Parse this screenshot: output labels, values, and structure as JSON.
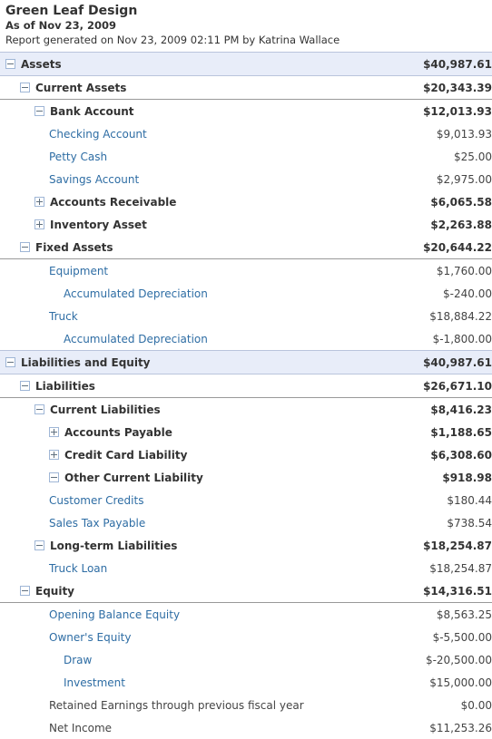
{
  "header": {
    "company": "Green Leaf Design",
    "as_of": "As of Nov 23, 2009",
    "generated": "Report generated on Nov 23, 2009 02:11 PM by Katrina Wallace"
  },
  "icons": {
    "collapse": "minus-square-icon",
    "expand": "plus-square-icon"
  },
  "colors": {
    "section_bg": "#e8edf9",
    "link": "#2e6da4",
    "text": "#333333",
    "rule": "#999999",
    "icon_border": "#9fb6d6"
  },
  "rows": [
    {
      "label": "Assets",
      "amount": "$40,987.61",
      "indent": 0,
      "toggle": "minus",
      "style": "section",
      "rule": false
    },
    {
      "label": "Current Assets",
      "amount": "$20,343.39",
      "indent": 1,
      "toggle": "minus",
      "style": "bold",
      "rule": true
    },
    {
      "label": "Bank Account",
      "amount": "$12,013.93",
      "indent": 2,
      "toggle": "minus",
      "style": "bold",
      "rule": false
    },
    {
      "label": "Checking Account",
      "amount": "$9,013.93",
      "indent": 3,
      "toggle": "none",
      "style": "link",
      "rule": false
    },
    {
      "label": "Petty Cash",
      "amount": "$25.00",
      "indent": 3,
      "toggle": "none",
      "style": "link",
      "rule": false
    },
    {
      "label": "Savings Account",
      "amount": "$2,975.00",
      "indent": 3,
      "toggle": "none",
      "style": "link",
      "rule": false
    },
    {
      "label": "Accounts Receivable",
      "amount": "$6,065.58",
      "indent": 2,
      "toggle": "plus",
      "style": "bold",
      "rule": false
    },
    {
      "label": "Inventory Asset",
      "amount": "$2,263.88",
      "indent": 2,
      "toggle": "plus",
      "style": "bold",
      "rule": false
    },
    {
      "label": "Fixed Assets",
      "amount": "$20,644.22",
      "indent": 1,
      "toggle": "minus",
      "style": "bold",
      "rule": true
    },
    {
      "label": "Equipment",
      "amount": "$1,760.00",
      "indent": 3,
      "toggle": "none",
      "style": "link",
      "rule": false
    },
    {
      "label": "Accumulated Depreciation",
      "amount": "$-240.00",
      "indent": 4,
      "toggle": "none",
      "style": "link",
      "rule": false
    },
    {
      "label": "Truck",
      "amount": "$18,884.22",
      "indent": 3,
      "toggle": "none",
      "style": "link",
      "rule": false
    },
    {
      "label": "Accumulated Depreciation",
      "amount": "$-1,800.00",
      "indent": 4,
      "toggle": "none",
      "style": "link",
      "rule": false
    },
    {
      "label": "Liabilities and Equity",
      "amount": "$40,987.61",
      "indent": 0,
      "toggle": "minus",
      "style": "section",
      "rule": false
    },
    {
      "label": "Liabilities",
      "amount": "$26,671.10",
      "indent": 1,
      "toggle": "minus",
      "style": "bold",
      "rule": true
    },
    {
      "label": "Current Liabilities",
      "amount": "$8,416.23",
      "indent": 2,
      "toggle": "minus",
      "style": "bold",
      "rule": false
    },
    {
      "label": "Accounts Payable",
      "amount": "$1,188.65",
      "indent": 3,
      "toggle": "plus",
      "style": "bold",
      "rule": false
    },
    {
      "label": "Credit Card Liability",
      "amount": "$6,308.60",
      "indent": 3,
      "toggle": "plus",
      "style": "bold",
      "rule": false
    },
    {
      "label": "Other Current Liability",
      "amount": "$918.98",
      "indent": 3,
      "toggle": "minus",
      "style": "bold",
      "rule": false
    },
    {
      "label": "Customer Credits",
      "amount": "$180.44",
      "indent": 3,
      "toggle": "none",
      "style": "link",
      "rule": false
    },
    {
      "label": "Sales Tax Payable",
      "amount": "$738.54",
      "indent": 3,
      "toggle": "none",
      "style": "link",
      "rule": false
    },
    {
      "label": "Long-term Liabilities",
      "amount": "$18,254.87",
      "indent": 2,
      "toggle": "minus",
      "style": "bold",
      "rule": false
    },
    {
      "label": "Truck Loan",
      "amount": "$18,254.87",
      "indent": 3,
      "toggle": "none",
      "style": "link",
      "rule": false
    },
    {
      "label": "Equity",
      "amount": "$14,316.51",
      "indent": 1,
      "toggle": "minus",
      "style": "bold",
      "rule": true
    },
    {
      "label": "Opening Balance Equity",
      "amount": "$8,563.25",
      "indent": 3,
      "toggle": "none",
      "style": "link",
      "rule": false
    },
    {
      "label": "Owner's Equity",
      "amount": "$-5,500.00",
      "indent": 3,
      "toggle": "none",
      "style": "link",
      "rule": false
    },
    {
      "label": "Draw",
      "amount": "$-20,500.00",
      "indent": 4,
      "toggle": "none",
      "style": "link",
      "rule": false
    },
    {
      "label": "Investment",
      "amount": "$15,000.00",
      "indent": 4,
      "toggle": "none",
      "style": "link",
      "rule": false
    },
    {
      "label": "Retained Earnings through previous fiscal year",
      "amount": "$0.00",
      "indent": 3,
      "toggle": "none",
      "style": "plain",
      "rule": false
    },
    {
      "label": "Net Income",
      "amount": "$11,253.26",
      "indent": 3,
      "toggle": "none",
      "style": "plain",
      "rule": false
    }
  ]
}
